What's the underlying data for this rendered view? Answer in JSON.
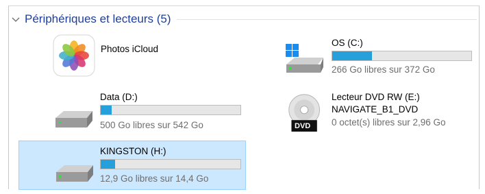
{
  "group": {
    "title": "Périphériques et lecteurs (5)"
  },
  "devices": {
    "icloud": {
      "name": "Photos iCloud"
    },
    "os": {
      "name": "OS (C:)",
      "space": "266 Go libres sur 372 Go",
      "used_fraction": 0.285
    },
    "data": {
      "name": "Data (D:)",
      "space": "500 Go libres sur 542 Go",
      "used_fraction": 0.077
    },
    "dvd": {
      "name": "Lecteur DVD RW (E:)",
      "label": "NAVIGATE_B1_DVD",
      "space": "0 octet(s) libres sur 2,96 Go",
      "badge": "DVD"
    },
    "kingston": {
      "name": "KINGSTON (H:)",
      "space": "12,9 Go libres sur 14,4 Go",
      "used_fraction": 0.104
    }
  },
  "colors": {
    "accent": "#1f3f9a",
    "bar_fill": "#26a0da",
    "selection": "#cce8ff"
  }
}
